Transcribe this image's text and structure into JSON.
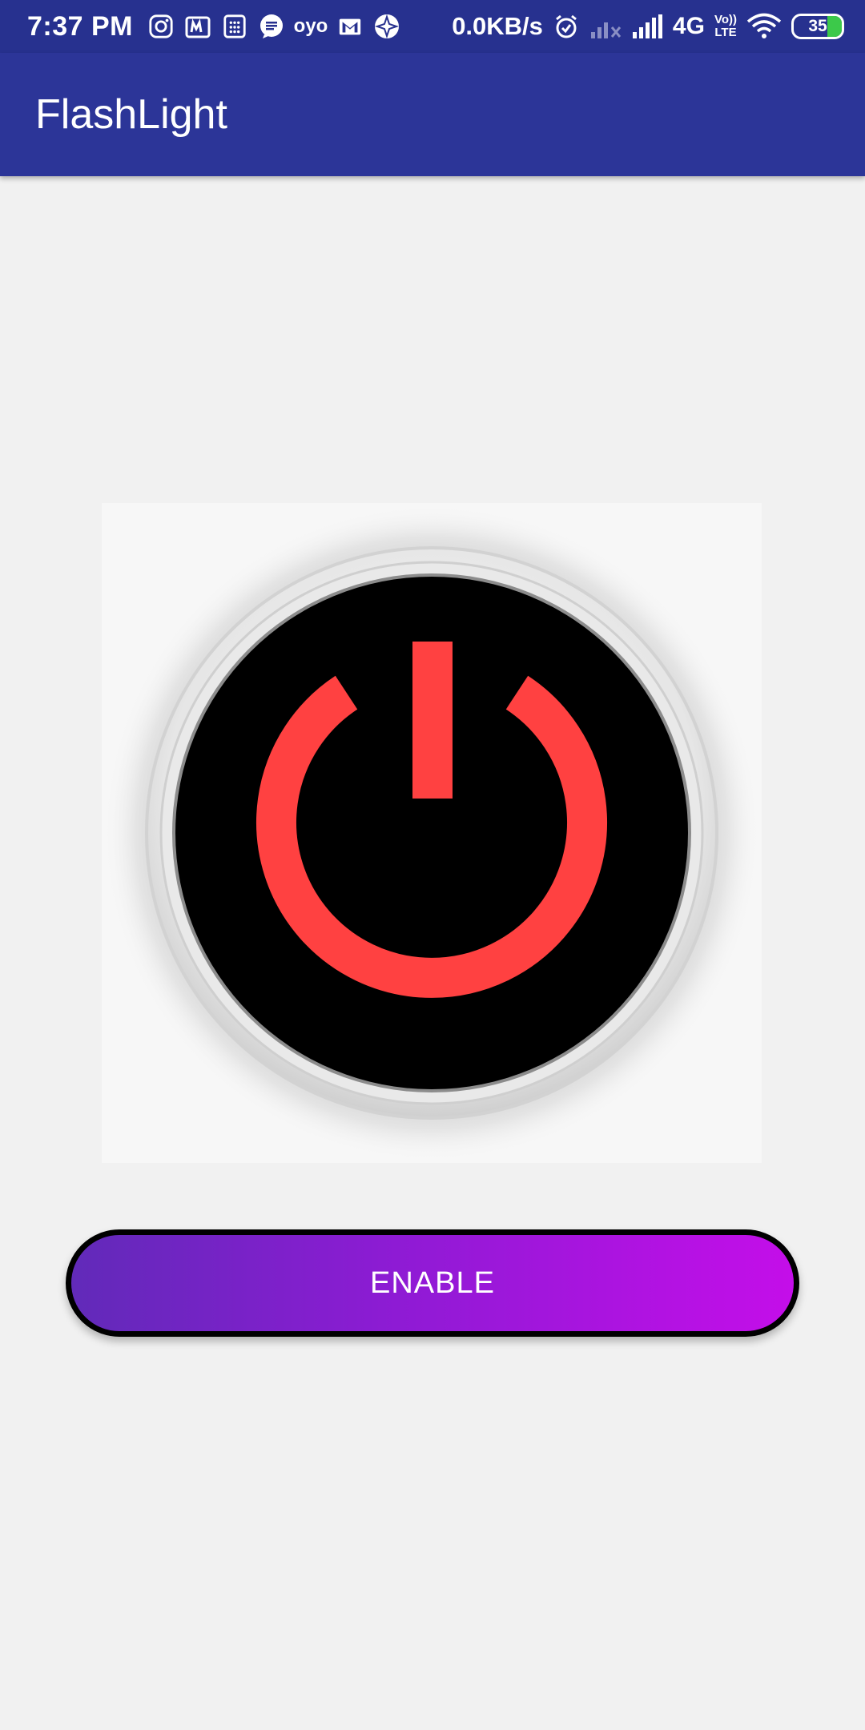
{
  "status_bar": {
    "time": "7:37 PM",
    "left_icons": [
      "instagram-icon",
      "myntra-icon",
      "calculator-icon",
      "message-icon",
      "oyo-icon",
      "gmail-icon",
      "browser-icon"
    ],
    "oyo_text": "oyo",
    "net_speed": "0.0KB/s",
    "network_type": "4G",
    "volte_top": "Vo))",
    "volte_bottom": "LTE",
    "battery_level": "35",
    "colors": {
      "background": "#27318f",
      "battery_charge": "#3cc94a"
    }
  },
  "app_bar": {
    "title": "FlashLight",
    "color": "#2c3598"
  },
  "main": {
    "power_image_icon": "power-icon",
    "power_symbol_color": "#ff4141",
    "enable_button": {
      "label": "ENABLE",
      "gradient_start": "#612ab9",
      "gradient_end": "#c40ee9"
    }
  }
}
